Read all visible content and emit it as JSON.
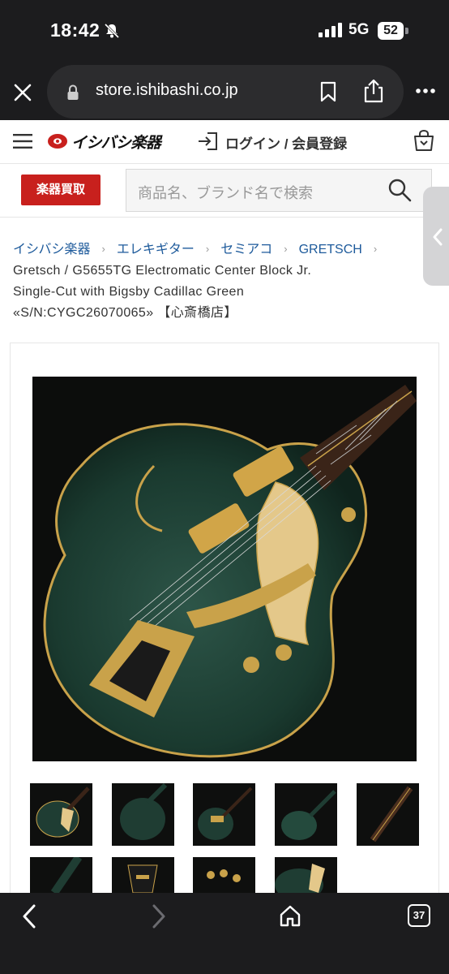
{
  "status_bar": {
    "time": "18:42",
    "network": "5G",
    "battery": "52"
  },
  "browser": {
    "url": "store.ishibashi.co.jp",
    "tab_count": "37"
  },
  "site": {
    "logo_text": "イシバシ楽器",
    "login_label": "ログイン / 会員登録",
    "buy_button": "楽器買取",
    "search_placeholder": "商品名、ブランド名で検索"
  },
  "breadcrumb": [
    "イシバシ楽器",
    "エレキギター",
    "セミアコ",
    "GRETSCH"
  ],
  "product": {
    "title_line1": "Gretsch / G5655TG Electromatic Center Block Jr.",
    "title_line2": "Single-Cut with Bigsby Cadillac Green",
    "title_line3": "«S/N:CYGC26070065» 【心斎橋店】"
  },
  "thumbnails": [
    "thumb-1",
    "thumb-2",
    "thumb-3",
    "thumb-4",
    "thumb-5",
    "thumb-6",
    "thumb-7",
    "thumb-8",
    "thumb-9"
  ],
  "colors": {
    "brand_red": "#c8201d",
    "link_blue": "#1d5a9b",
    "guitar_green": "#1f3d33",
    "gold": "#c9a24a"
  }
}
